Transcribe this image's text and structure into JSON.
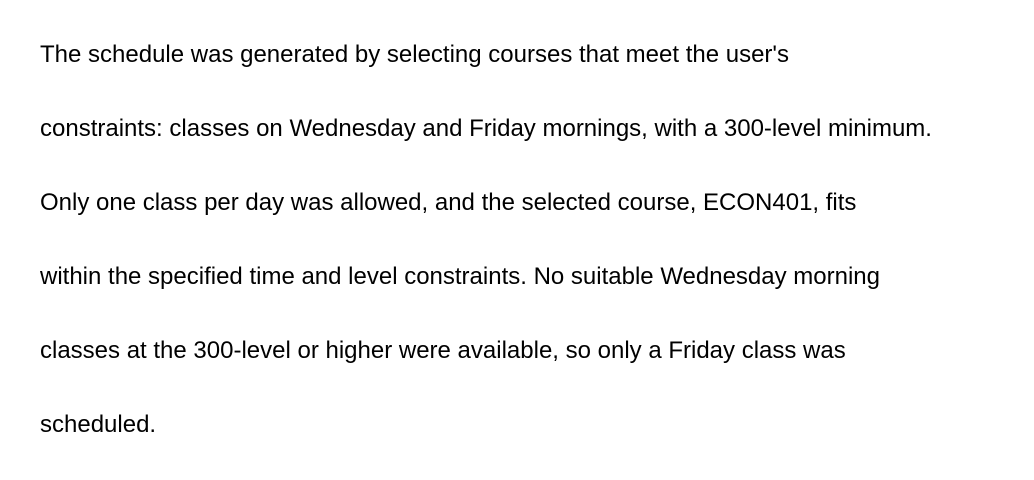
{
  "document": {
    "lines": [
      "The schedule was generated by selecting courses that meet the user's",
      "constraints: classes on Wednesday and Friday mornings, with a 300-level minimum.",
      "Only one class per day was allowed, and the selected course, ECON401, fits",
      "within the specified time and level constraints. No suitable Wednesday morning",
      "classes at the 300-level or higher were available, so only a Friday class was",
      "scheduled."
    ]
  }
}
